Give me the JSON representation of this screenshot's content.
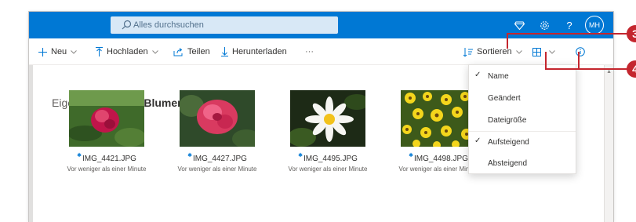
{
  "search": {
    "placeholder": "Alles durchsuchen"
  },
  "top_icons": [
    "diamond-icon",
    "gear-icon",
    "help-icon"
  ],
  "top": {
    "help_glyph": "?",
    "avatar_initials": "MH"
  },
  "toolbar": {
    "new_label": "Neu",
    "upload_label": "Hochladen",
    "share_label": "Teilen",
    "download_label": "Herunterladen",
    "more_label": "···",
    "sort_label": "Sortieren"
  },
  "breadcrumb": {
    "parent": "Eigene Dateien",
    "separator": ">",
    "current": "Blumen"
  },
  "files": [
    {
      "name": "IMG_4421.JPG",
      "modified": "Vor weniger als einer Minute"
    },
    {
      "name": "IMG_4427.JPG",
      "modified": "Vor weniger als einer Minute"
    },
    {
      "name": "IMG_4495.JPG",
      "modified": "Vor weniger als einer Minute"
    },
    {
      "name": "IMG_4498.JPG",
      "modified": "Vor weniger als einer Minute"
    }
  ],
  "sort_menu": {
    "items": [
      {
        "label": "Name",
        "checked": true
      },
      {
        "label": "Geändert",
        "checked": false
      },
      {
        "label": "Dateigröße",
        "checked": false
      },
      {
        "label": "Aufsteigend",
        "checked": true
      },
      {
        "label": "Absteigend",
        "checked": false
      }
    ],
    "check_glyph": "✓"
  },
  "callouts": {
    "sort": "3",
    "view": "4"
  },
  "colors": {
    "accent": "#0078d4",
    "callout": "#c4262e"
  }
}
